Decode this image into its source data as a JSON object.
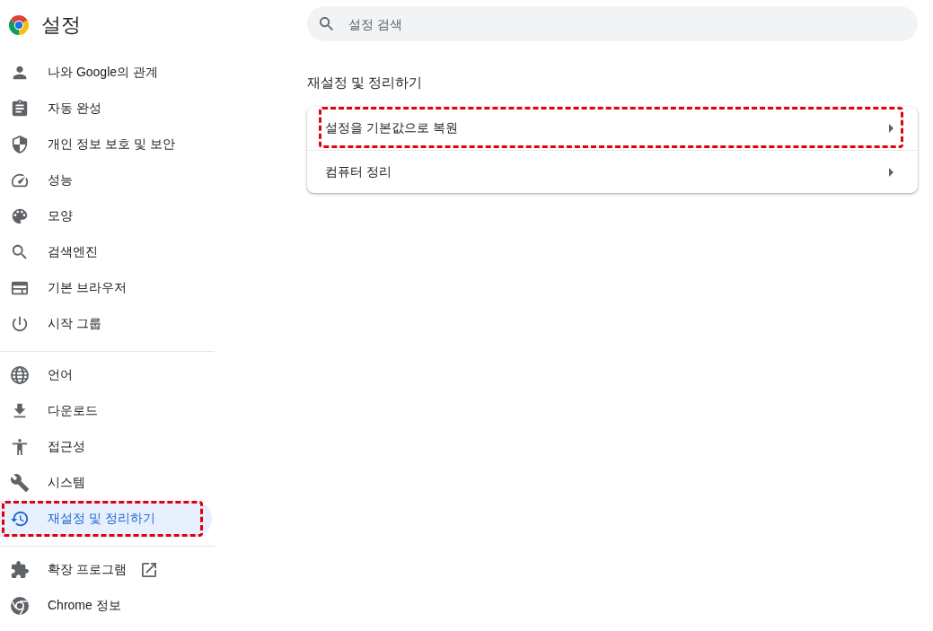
{
  "header": {
    "title": "설정"
  },
  "search": {
    "placeholder": "설정 검색"
  },
  "sidebar": {
    "groups": [
      {
        "items": [
          {
            "label": "나와 Google의 관계",
            "selected": false,
            "external": false,
            "highlighted": false
          },
          {
            "label": "자동 완성",
            "selected": false,
            "external": false,
            "highlighted": false
          },
          {
            "label": "개인 정보 보호 및 보안",
            "selected": false,
            "external": false,
            "highlighted": false
          },
          {
            "label": "성능",
            "selected": false,
            "external": false,
            "highlighted": false
          },
          {
            "label": "모양",
            "selected": false,
            "external": false,
            "highlighted": false
          },
          {
            "label": "검색엔진",
            "selected": false,
            "external": false,
            "highlighted": false
          },
          {
            "label": "기본 브라우저",
            "selected": false,
            "external": false,
            "highlighted": false
          },
          {
            "label": "시작 그룹",
            "selected": false,
            "external": false,
            "highlighted": false
          }
        ]
      },
      {
        "items": [
          {
            "label": "언어",
            "selected": false,
            "external": false,
            "highlighted": false
          },
          {
            "label": "다운로드",
            "selected": false,
            "external": false,
            "highlighted": false
          },
          {
            "label": "접근성",
            "selected": false,
            "external": false,
            "highlighted": false
          },
          {
            "label": "시스템",
            "selected": false,
            "external": false,
            "highlighted": false
          },
          {
            "label": "재설정 및 정리하기",
            "selected": true,
            "external": false,
            "highlighted": true
          }
        ]
      },
      {
        "items": [
          {
            "label": "확장 프로그램",
            "selected": false,
            "external": true,
            "highlighted": false
          },
          {
            "label": "Chrome 정보",
            "selected": false,
            "external": false,
            "highlighted": false
          }
        ]
      }
    ]
  },
  "section": {
    "title": "재설정 및 정리하기",
    "rows": [
      {
        "label": "설정을 기본값으로 복원",
        "highlighted": true
      },
      {
        "label": "컴퓨터 정리",
        "highlighted": false
      }
    ]
  }
}
